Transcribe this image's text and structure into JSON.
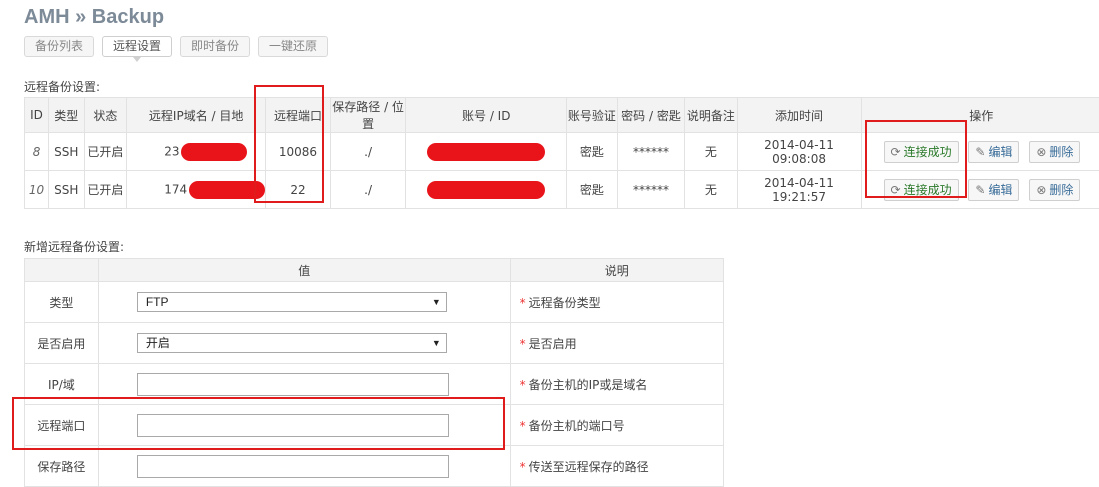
{
  "page": {
    "title": "AMH » Backup"
  },
  "tabs": [
    "备份列表",
    "远程设置",
    "即时备份",
    "一键还原"
  ],
  "remote_section": {
    "label": "远程备份设置:",
    "headers": [
      "ID",
      "类型",
      "状态",
      "远程IP域名 / 目地",
      "远程端口",
      "保存路径 / 位置",
      "账号 / ID",
      "账号验证",
      "密码 / 密匙",
      "说明备注",
      "添加时间",
      "操作"
    ],
    "rows": [
      {
        "id": "8",
        "type": "SSH",
        "status": "已开启",
        "ip_prefix": "23",
        "port": "10086",
        "path": "./",
        "auth": "密匙",
        "password": "******",
        "note": "无",
        "time": "2014-04-11 09:08:08",
        "test_label": "连接成功",
        "edit_label": "编辑",
        "delete_label": "删除"
      },
      {
        "id": "10",
        "type": "SSH",
        "status": "已开启",
        "ip_prefix": "174",
        "port": "22",
        "path": "./",
        "auth": "密匙",
        "password": "******",
        "note": "无",
        "time": "2014-04-11 19:21:57",
        "test_label": "连接成功",
        "edit_label": "编辑",
        "delete_label": "删除"
      }
    ]
  },
  "new_section": {
    "label": "新增远程备份设置:",
    "headers": [
      "",
      "值",
      "说明"
    ],
    "rows": [
      {
        "label": "类型",
        "kind": "select",
        "value": "FTP",
        "desc": "远程备份类型"
      },
      {
        "label": "是否启用",
        "kind": "select",
        "value": "开启",
        "desc": "是否启用"
      },
      {
        "label": "IP/域",
        "kind": "input",
        "value": "",
        "desc": "备份主机的IP或是域名"
      },
      {
        "label": "远程端口",
        "kind": "input",
        "value": "",
        "desc": "备份主机的端口号"
      },
      {
        "label": "保存路径",
        "kind": "input",
        "value": "",
        "desc": "传送至远程保存的路径"
      }
    ]
  },
  "icons": {
    "refresh": "refresh-icon",
    "edit": "pencil-icon",
    "delete": "close-circle-icon",
    "dropdown": "dropdown-arrow-icon"
  },
  "colors": {
    "enabled": "#2a8a2a",
    "highlight": "#e01b1b",
    "redaction": "#e8141a"
  }
}
